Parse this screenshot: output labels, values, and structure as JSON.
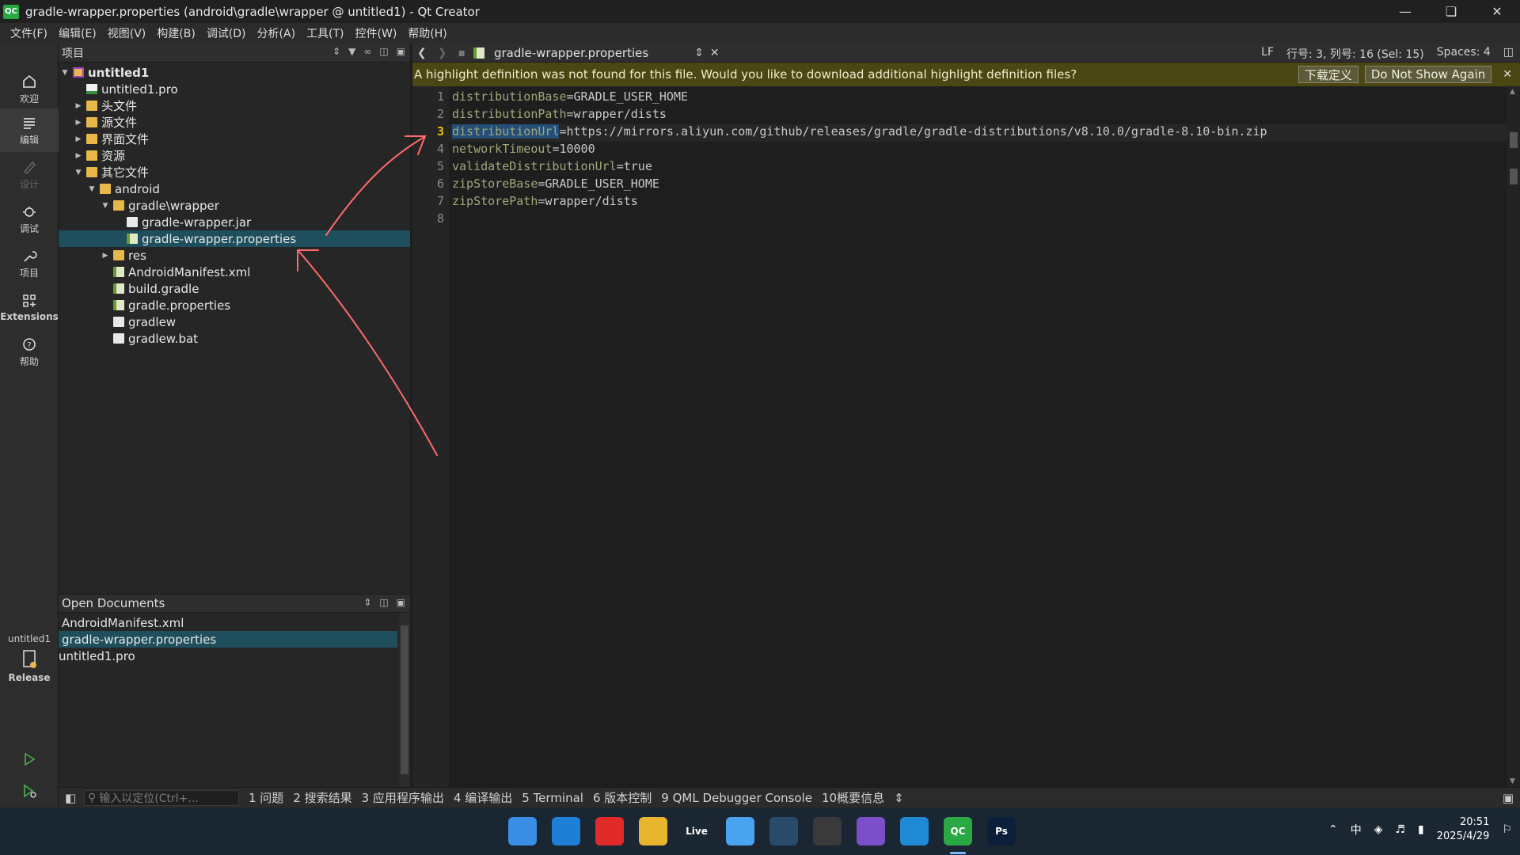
{
  "window": {
    "title": "gradle-wrapper.properties (android\\gradle\\wrapper @ untitled1) - Qt Creator",
    "app_icon_text": "QC"
  },
  "menu": [
    "文件(F)",
    "编辑(E)",
    "视图(V)",
    "构建(B)",
    "调试(D)",
    "分析(A)",
    "工具(T)",
    "控件(W)",
    "帮助(H)"
  ],
  "modes": {
    "welcome": "欢迎",
    "edit": "编辑",
    "design": "设计",
    "debug": "调试",
    "project": "项目",
    "extensions": "Extensions",
    "help": "帮助",
    "kit_name": "untitled1",
    "build_config": "Release"
  },
  "projects_panel": {
    "title": "项目",
    "tree": [
      {
        "label": "untitled1",
        "depth": 0,
        "expand": "open",
        "icon": "project",
        "bold": true
      },
      {
        "label": "untitled1.pro",
        "depth": 1,
        "expand": "none",
        "icon": "pro-file"
      },
      {
        "label": "头文件",
        "depth": 1,
        "expand": "closed",
        "icon": "folder"
      },
      {
        "label": "源文件",
        "depth": 1,
        "expand": "closed",
        "icon": "folder"
      },
      {
        "label": "界面文件",
        "depth": 1,
        "expand": "closed",
        "icon": "folder"
      },
      {
        "label": "资源",
        "depth": 1,
        "expand": "closed",
        "icon": "folder"
      },
      {
        "label": "其它文件",
        "depth": 1,
        "expand": "open",
        "icon": "folder"
      },
      {
        "label": "android",
        "depth": 2,
        "expand": "open",
        "icon": "folder"
      },
      {
        "label": "gradle\\wrapper",
        "depth": 3,
        "expand": "open",
        "icon": "folder"
      },
      {
        "label": "gradle-wrapper.jar",
        "depth": 4,
        "expand": "none",
        "icon": "file"
      },
      {
        "label": "gradle-wrapper.properties",
        "depth": 4,
        "expand": "none",
        "icon": "green-file",
        "selected": true
      },
      {
        "label": "res",
        "depth": 3,
        "expand": "closed",
        "icon": "folder"
      },
      {
        "label": "AndroidManifest.xml",
        "depth": 3,
        "expand": "none",
        "icon": "green-file"
      },
      {
        "label": "build.gradle",
        "depth": 3,
        "expand": "none",
        "icon": "green-file"
      },
      {
        "label": "gradle.properties",
        "depth": 3,
        "expand": "none",
        "icon": "green-file"
      },
      {
        "label": "gradlew",
        "depth": 3,
        "expand": "none",
        "icon": "file"
      },
      {
        "label": "gradlew.bat",
        "depth": 3,
        "expand": "none",
        "icon": "file"
      }
    ]
  },
  "open_documents": {
    "title": "Open Documents",
    "items": [
      {
        "label": "AndroidManifest.xml",
        "icon": "green-file"
      },
      {
        "label": "gradle-wrapper.properties",
        "icon": "green-file",
        "selected": true
      },
      {
        "label": "untitled1.pro",
        "icon": "pro-file"
      }
    ]
  },
  "editor": {
    "document": "gradle-wrapper.properties",
    "line_ending": "LF",
    "cursor": "行号: 3, 列号: 16 (Sel: 15)",
    "indent": "Spaces: 4",
    "current_line": 3,
    "lines": [
      {
        "n": "1",
        "key": "distributionBase",
        "value": "=GRADLE_USER_HOME"
      },
      {
        "n": "2",
        "key": "distributionPath",
        "value": "=wrapper/dists"
      },
      {
        "n": "3",
        "key": "distributionUrl",
        "value": "=https://mirrors.aliyun.com/github/releases/gradle/gradle-distributions/v8.10.0/gradle-8.10-bin.zip",
        "selected": true
      },
      {
        "n": "4",
        "key": "networkTimeout",
        "value": "=10000"
      },
      {
        "n": "5",
        "key": "validateDistributionUrl",
        "value": "=true"
      },
      {
        "n": "6",
        "key": "zipStoreBase",
        "value": "=GRADLE_USER_HOME"
      },
      {
        "n": "7",
        "key": "zipStorePath",
        "value": "=wrapper/dists"
      },
      {
        "n": "8",
        "key": "",
        "value": ""
      }
    ]
  },
  "infobar": {
    "message": "A highlight definition was not found for this file. Would you like to download additional highlight definition files?",
    "download_label": "下载定义",
    "dont_show_label": "Do Not Show Again"
  },
  "output_bar": {
    "locator_placeholder": "输入以定位(Ctrl+...",
    "tabs": [
      "1 问题",
      "2 搜索结果",
      "3 应用程序输出",
      "4 编译输出",
      "5 Terminal",
      "6 版本控制",
      "9 QML Debugger Console",
      "10概要信息"
    ]
  },
  "taskbar": {
    "apps": [
      {
        "name": "windows-start",
        "color": "#3a8ee6",
        "text": ""
      },
      {
        "name": "edge",
        "color": "#1f7fd6",
        "text": ""
      },
      {
        "name": "netease-music",
        "color": "#e02a2a",
        "text": ""
      },
      {
        "name": "file-explorer",
        "color": "#e8b52e",
        "text": ""
      },
      {
        "name": "live",
        "color": "#1b2633",
        "text": "Live"
      },
      {
        "name": "security",
        "color": "#4aa3f0",
        "text": ""
      },
      {
        "name": "steam",
        "color": "#2a4a6a",
        "text": ""
      },
      {
        "name": "unity",
        "color": "#3a3a3a",
        "text": ""
      },
      {
        "name": "visual-studio",
        "color": "#7a4fc8",
        "text": ""
      },
      {
        "name": "vscode",
        "color": "#1e8ad6",
        "text": ""
      },
      {
        "name": "qt-creator",
        "color": "#2aa844",
        "text": "QC"
      },
      {
        "name": "photoshop",
        "color": "#0b1f3a",
        "text": "Ps"
      }
    ],
    "ime": "中",
    "time": "20:51",
    "date": "2025/4/29"
  }
}
